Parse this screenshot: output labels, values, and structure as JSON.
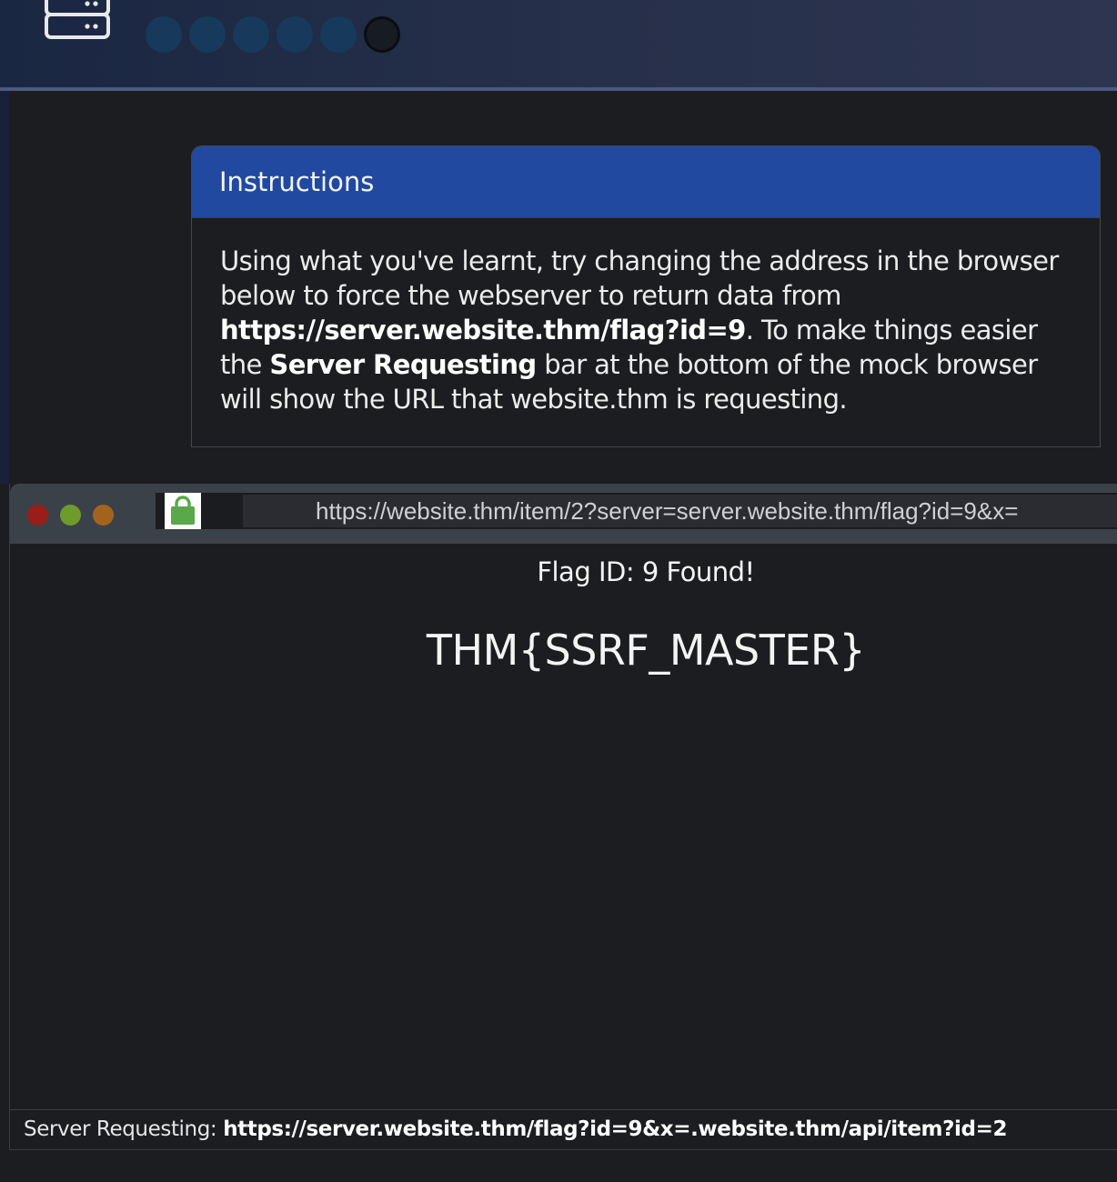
{
  "header": {
    "icon": "server-icon",
    "progress": {
      "completed": 5,
      "total": 6
    }
  },
  "instructions": {
    "title": "Instructions",
    "text_1": "Using what you've learnt, try changing the address in the browser below to force the webserver to return data from ",
    "target_url": "https://server.website.thm/flag?id=9",
    "text_2": ". To make things easier the ",
    "bar_name": "Server Requesting",
    "text_3": " bar at the bottom of the mock browser will show the URL that website.thm is requesting."
  },
  "browser": {
    "address": "https://website.thm/item/2?server=server.website.thm/flag?id=9&x=",
    "lock_icon": "lock-icon",
    "flag_message": "Flag ID: 9 Found!",
    "flag_value": "THM{SSRF_MASTER}",
    "status_label": "Server Requesting: ",
    "status_url": "https://server.website.thm/flag?id=9&x=.website.thm/api/item?id=2"
  },
  "colors": {
    "accent": "#2149a0",
    "dot_complete": "#173a5c",
    "lock": "#5aa84a"
  }
}
